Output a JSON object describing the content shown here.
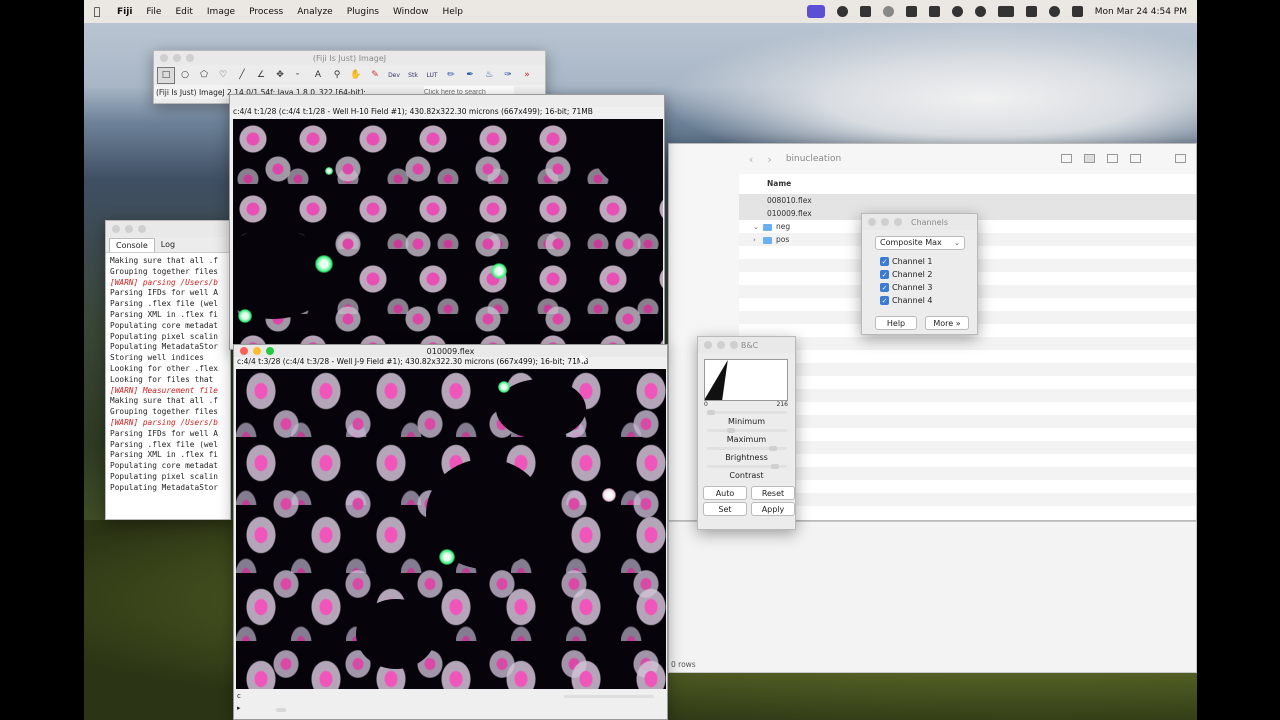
{
  "menubar": {
    "app": "Fiji",
    "items": [
      "File",
      "Edit",
      "Image",
      "Process",
      "Analyze",
      "Plugins",
      "Window",
      "Help"
    ],
    "clock": "Mon Mar 24  4:54 PM"
  },
  "fiji": {
    "title": "(Fiji Is Just) ImageJ",
    "status": "(Fiji Is Just) ImageJ 2.14.0/1.54f; Java 1.8.0_322 [64-bit];",
    "search_placeholder": "Click here to search",
    "tool_text": [
      "Dev",
      "Stk",
      "LUT"
    ]
  },
  "image1": {
    "info": "c:4/4 t:1/28 (c:4/4 t:1/28 - Well H-10  Field #1); 430.82x322.30 microns (667x499); 16-bit; 71MB"
  },
  "image2": {
    "title": "010009.flex",
    "info": "c:4/4 t:3/28 (c:4/4 t:3/28 - Well J-9  Field #1); 430.82x322.30 microns (667x499); 16-bit; 71MB",
    "channel_slider_label": "c",
    "play_label": "▸"
  },
  "console": {
    "tabs": [
      "Console",
      "Log"
    ],
    "lines": [
      {
        "text": "Making sure that all .f",
        "warn": false
      },
      {
        "text": "Grouping together files",
        "warn": false
      },
      {
        "text": "[WARN] parsing /Users/b",
        "warn": true
      },
      {
        "text": "Parsing IFDs for well A",
        "warn": false
      },
      {
        "text": "Parsing .flex file (wel",
        "warn": false
      },
      {
        "text": "Parsing XML in .flex fi",
        "warn": false
      },
      {
        "text": "Populating core metadat",
        "warn": false
      },
      {
        "text": "Populating pixel scalin",
        "warn": false
      },
      {
        "text": "Populating MetadataStor",
        "warn": false
      },
      {
        "text": "Storing well indices",
        "warn": false
      },
      {
        "text": "Looking for other .flex",
        "warn": false
      },
      {
        "text": "Looking for files that ",
        "warn": false
      },
      {
        "text": "[WARN] Measurement file",
        "warn": true
      },
      {
        "text": "Making sure that all .f",
        "warn": false
      },
      {
        "text": "Grouping together files",
        "warn": false
      },
      {
        "text": "[WARN] parsing /Users/b",
        "warn": true
      },
      {
        "text": "Parsing IFDs for well A",
        "warn": false
      },
      {
        "text": "Parsing .flex file (wel",
        "warn": false
      },
      {
        "text": "Parsing XML in .flex fi",
        "warn": false
      },
      {
        "text": "Populating core metadat",
        "warn": false
      },
      {
        "text": "Populating pixel scalin",
        "warn": false
      },
      {
        "text": "Populating MetadataStor",
        "warn": false
      }
    ]
  },
  "finder": {
    "folder": "binucleation",
    "column_name": "Name",
    "rows": [
      {
        "name": "008010.flex",
        "type": "file"
      },
      {
        "name": "010009.flex",
        "type": "file"
      },
      {
        "name": "neg",
        "type": "folder"
      },
      {
        "name": "pos",
        "type": "folder"
      }
    ],
    "status": "0 rows"
  },
  "channels": {
    "title": "Channels",
    "mode": "Composite Max",
    "items": [
      "Channel 1",
      "Channel 2",
      "Channel 3",
      "Channel 4"
    ],
    "help": "Help",
    "more": "More »"
  },
  "bc": {
    "title": "B&C",
    "hist_min": "0",
    "hist_max": "216",
    "labels": [
      "Minimum",
      "Maximum",
      "Brightness",
      "Contrast"
    ],
    "buttons": [
      "Auto",
      "Reset",
      "Set",
      "Apply"
    ]
  }
}
